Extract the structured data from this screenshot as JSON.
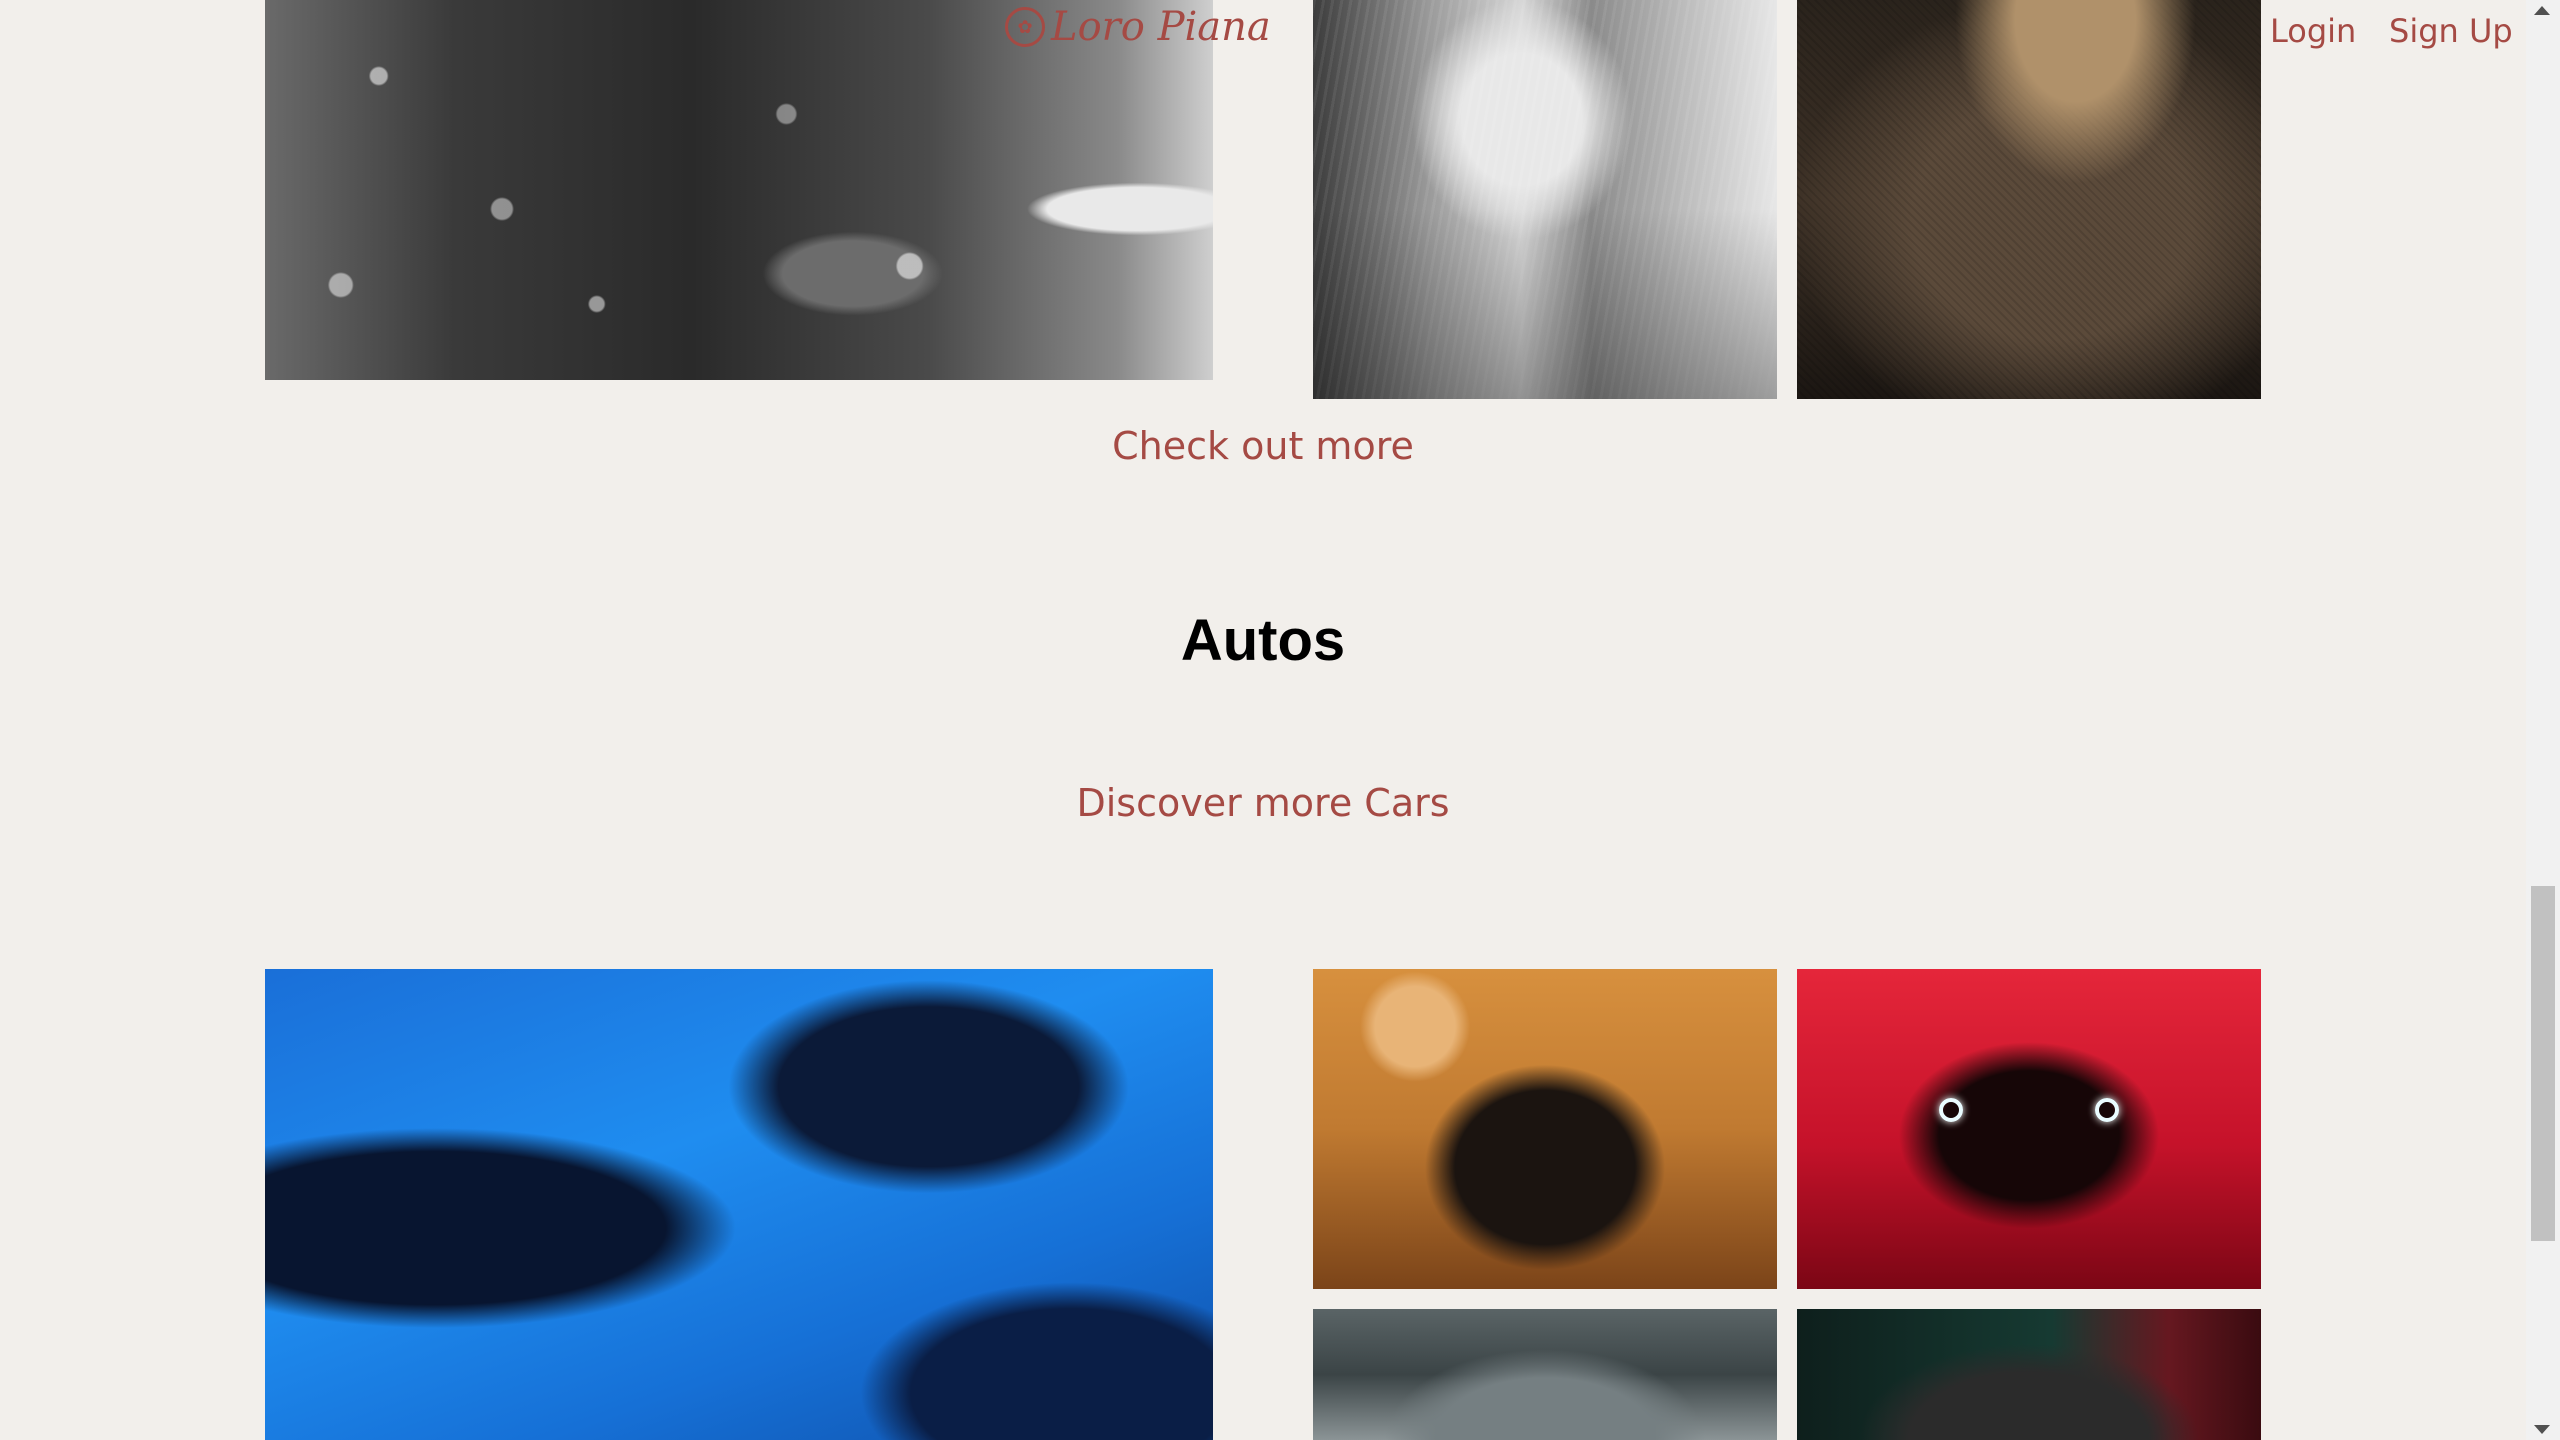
{
  "header": {
    "logo_text": "Loro Piana",
    "login_label": "Login",
    "signup_label": "Sign Up"
  },
  "fashion_section": {
    "more_link": "Check out more",
    "images": [
      "snowy-coat-photo",
      "silver-dress-photo",
      "knit-sweater-photo"
    ]
  },
  "autos_section": {
    "title": "Autos",
    "more_link": "Discover more Cars",
    "images": [
      "brabus-lineup-photo",
      "desert-coupe-photo",
      "red-suv-photo",
      "garage-car-photo",
      "dark-suv-photo"
    ]
  },
  "colors": {
    "accent": "#a54a44",
    "background": "#f2efeb"
  }
}
